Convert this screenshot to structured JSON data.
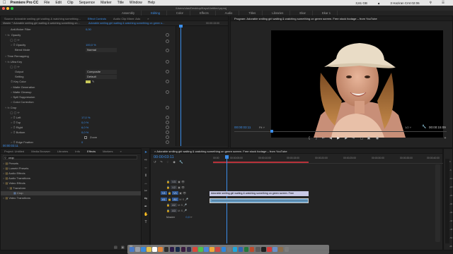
{
  "menubar": {
    "app": "Premiere Pro CC",
    "items": [
      "File",
      "Edit",
      "Clip",
      "Sequence",
      "Marker",
      "Title",
      "Window",
      "Help"
    ],
    "battery": "3,61 GB",
    "clock": "3 Haziran Cmt 02:06"
  },
  "window_title": "/Users/ulas/Desktop/Keyu/Untitled.prproj",
  "workspaces": [
    "Assembly",
    "Editing",
    "Color",
    "Effects",
    "Audio",
    "Titles",
    "Libraries",
    "Ekar",
    "Ekar 1"
  ],
  "source_panel": {
    "tabs": [
      "Source: Adorable smiling girl waiting & watching something...",
      "Effect Controls",
      "Audio Clip Mixer: Ado",
      "»"
    ],
    "master_label": "Master * Adorable smiling girl waiting & watching something on...",
    "sequence_label": "Adorable smiling girl waiting & watching something on green s...",
    "mini_time": "00:00:15:00"
  },
  "effect_controls": {
    "rows": [
      {
        "label": "Anti-flicker Filter",
        "value": "0,00"
      },
      {
        "label": "Opacity",
        "value": ""
      },
      {
        "label": "Opacity",
        "value": "100,0 %"
      },
      {
        "label": "Blend Mode",
        "value": "Normal"
      },
      {
        "label": "Time Remapping",
        "value": ""
      },
      {
        "label": "Ultra Key",
        "value": ""
      },
      {
        "label": "Output",
        "value": "Composite"
      },
      {
        "label": "Setting",
        "value": "Default"
      },
      {
        "label": "Key Color",
        "value": ""
      },
      {
        "label": "Matte Generation",
        "value": ""
      },
      {
        "label": "Matte Cleanup",
        "value": ""
      },
      {
        "label": "Spill Suppression",
        "value": ""
      },
      {
        "label": "Color Correction",
        "value": ""
      },
      {
        "label": "Crop",
        "value": ""
      },
      {
        "label": "Left",
        "value": "17,0 %"
      },
      {
        "label": "Top",
        "value": "0,0 %"
      },
      {
        "label": "Right",
        "value": "6,0 %"
      },
      {
        "label": "Bottom",
        "value": "0,0 %"
      },
      {
        "label": "Zoom",
        "value": ""
      },
      {
        "label": "Edge Feather",
        "value": "0"
      }
    ],
    "timecode": "00:00:03:11"
  },
  "project_panel": {
    "tabs": [
      "Project: Untitled",
      "Media Browser",
      "Libraries",
      "Info",
      "Effects",
      "Markers",
      "»"
    ],
    "search_value": "crop",
    "tree": [
      {
        "label": "Presets",
        "level": 0
      },
      {
        "label": "Lumetri Presets",
        "level": 0
      },
      {
        "label": "Audio Effects",
        "level": 0
      },
      {
        "label": "Audio Transitions",
        "level": 0
      },
      {
        "label": "Video Effects",
        "level": 0
      },
      {
        "label": "Transform",
        "level": 1
      },
      {
        "label": "Crop",
        "level": 2
      },
      {
        "label": "Video Transitions",
        "level": 0
      }
    ]
  },
  "program": {
    "title": "Program: Adorable smiling girl waiting & watching something on green screen. Free stock footage – from YouTube",
    "timecode": "00:00:03:11",
    "fit": "Fit",
    "fraction": "1/2",
    "duration": "00:00:15:09"
  },
  "timeline": {
    "title": "Adorable smiling girl waiting & watching something on green screen. Free stock footage – from YouTube",
    "timecode": "00:00:03:11",
    "ruler": [
      "00:00",
      "00:00:05:00",
      "00:00:10:00",
      "00:00:15:00",
      "00:00:20:00",
      "00:00:25:00",
      "00:00:30:00",
      "00:00:35:00",
      "00:00:40:00"
    ],
    "tracks": [
      "V3",
      "V2",
      "V1",
      "A1",
      "A2",
      "A3",
      "Master"
    ],
    "clip_v1": "Adorable smiling girl waiting & watching something on green screen. Free",
    "master_value": "0,0"
  },
  "meter_scale": [
    "0",
    "-6",
    "-12",
    "-18",
    "-24",
    "-30",
    "-36",
    "-42",
    "-48",
    "-54",
    "dB"
  ]
}
